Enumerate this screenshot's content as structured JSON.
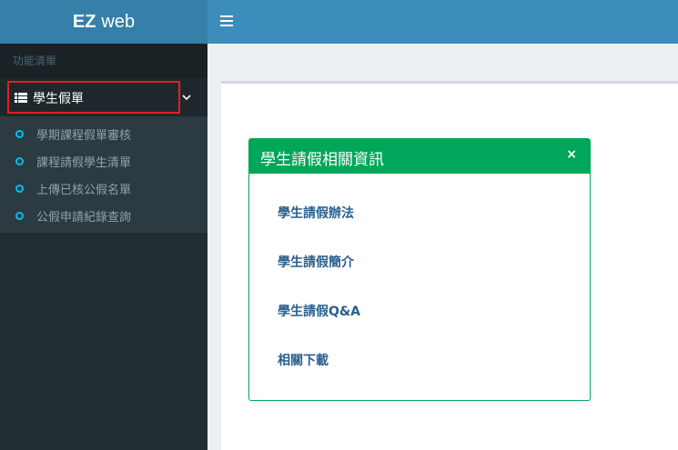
{
  "brand": {
    "bold": "EZ",
    "rest": "web"
  },
  "sidebar": {
    "header": "功能清單",
    "active_item": "學生假單",
    "subitems": [
      {
        "label": "學期課程假單審核"
      },
      {
        "label": "課程請假學生清單"
      },
      {
        "label": "上傳已核公假名單"
      },
      {
        "label": "公假申請紀錄查詢"
      }
    ]
  },
  "box": {
    "title": "學生請假相關資訊",
    "close": "×",
    "links": [
      {
        "label": "學生請假辦法"
      },
      {
        "label": "學生請假簡介"
      },
      {
        "label": "學生請假Q&A"
      },
      {
        "label": "相關下載"
      }
    ]
  },
  "colors": {
    "header": "#3c8dbc",
    "logo_bg": "#367fa9",
    "sidebar": "#222d32",
    "box_accent": "#00a65a",
    "highlight": "#e31e25"
  }
}
